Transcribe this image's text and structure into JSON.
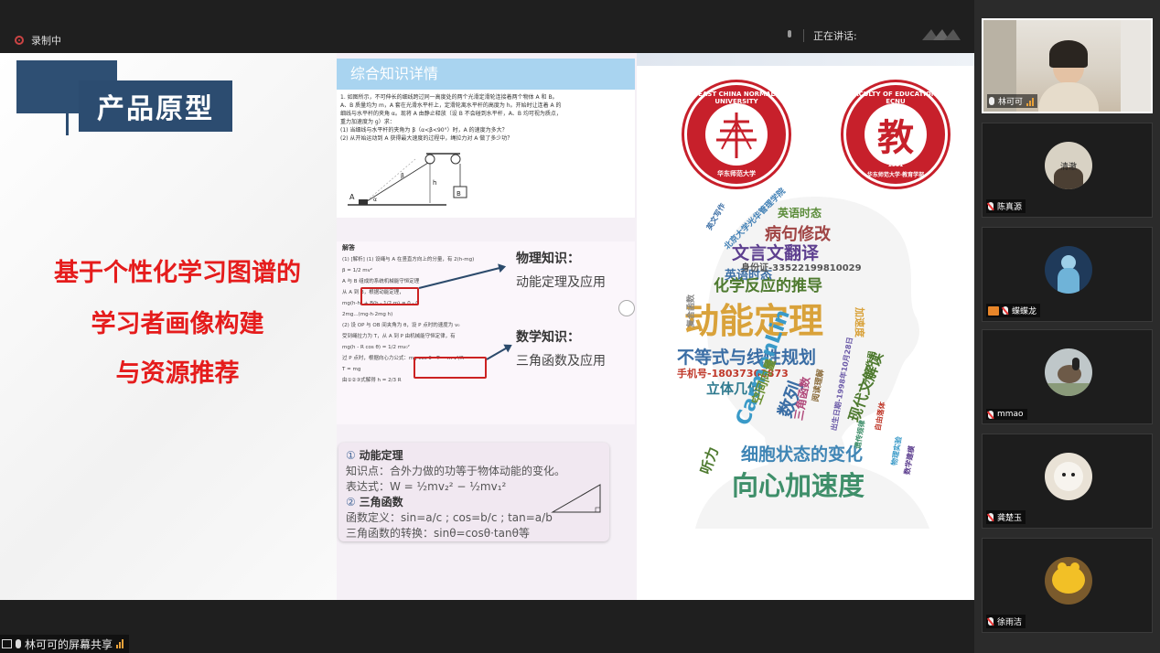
{
  "topbar": {
    "recording_label": "录制中",
    "speaking_label": "正在讲话:"
  },
  "slide": {
    "left": {
      "title": "产品原型",
      "lines": [
        "基于个性化学习图谱的",
        "学习者画像构建",
        "与资源推荐"
      ]
    },
    "middle": {
      "header": "综合知识详情",
      "question_lines": [
        "1. 如图所示，不可伸长的细线跨过同一高度处的两个光滑定滑轮连接着两个物体 A 和 B。",
        "A、B 质量均为 m，A 套在光滑水平杆上，定滑轮离水平杆的高度为 h。开始时让连着 A 的",
        "细线与水平杆的夹角 α。现将 A 由静止释放（设 B 不会碰到水平杆，A、B 均可视为质点，",
        "重力加速度为 g）求：",
        "(1) 当细线与水平杆的夹角为 β（α<β<90°）时，A 的速度为多大？",
        "(2) 从开始运动到 A 获得最大速度的过程中，绳拉力对 A 做了多少功？"
      ],
      "diagram_labels": {
        "a": "A",
        "b": "B",
        "h": "h",
        "alpha": "α",
        "beta": "β"
      },
      "solution_label": "解答",
      "solution_lines": [
        "(1) [解析] (1) 设绳与 A 在竖直方向上的分量，有 2(h-mg)",
        "β = 1/2 mv²",
        "A 与 B 组成的系统机械能守恒定理",
        "从 A 到 B，根据动能定理，",
        "mg(h-h) + B(h - 1/2 m) = 0 - 0",
        "2mg...(mg·h·2mg h)",
        "(2) 设 OP 与 OB 间夹角为 θ，设 P 点时的速度为 v₀",
        "受到绳拉力为 T，从 A 到 P 由机械能守恒定律，有",
        "mg(h - R cos θ) = 1/2 mv₀²",
        "过 P 点时，根据向心力公式：mg cos θ - T = m v²/R",
        "T = mg",
        "由①②③式解得 h = 2/3 R"
      ],
      "physics_title": "物理知识：",
      "physics_sub": "动能定理及应用",
      "math_title": "数学知识：",
      "math_sub": "三角函数及应用",
      "card": {
        "item1_num": "①",
        "item1_title": "动能定理",
        "item1_line1": "知识点：合外力做的功等于物体动能的变化。",
        "item1_line2": "表达式：W = ½mv₂² − ½mv₁²",
        "item2_num": "②",
        "item2_title": "三角函数",
        "item2_line1": "函数定义：sin=a/c ; cos=b/c ; tan=a/b",
        "item2_line2": "三角函数的转换：sinθ=cosθ·tanθ等"
      }
    },
    "right": {
      "seal1_text": "EAST CHINA NORMAL UNIVERSITY",
      "seal1_bottom": "华东师范大学",
      "seal2_text": "FACULTY OF EDUCATION · ECNU",
      "seal2_bottom": "华东师范大学·教育学部",
      "seal2_year": "1951",
      "wordcloud": [
        {
          "text": "动能定理",
          "color": "#d9a23a"
        },
        {
          "text": "向心加速度",
          "color": "#3f8f6a"
        },
        {
          "text": "化学反应的推导",
          "color": "#4e7a2f"
        },
        {
          "text": "不等式与线性规划",
          "color": "#3b6ea5"
        },
        {
          "text": "细胞状态的变化",
          "color": "#3f85b5"
        },
        {
          "text": "文言文翻译",
          "color": "#5d3f8f"
        },
        {
          "text": "病句修改",
          "color": "#a04545"
        },
        {
          "text": "英语时态",
          "color": "#5b8c3a"
        },
        {
          "text": "身份证-33522199810029",
          "color": "#555555"
        },
        {
          "text": "手机号-18037362873",
          "color": "#c0392b"
        },
        {
          "text": "立体几何",
          "color": "#2f7a8f"
        },
        {
          "text": "CarmenLin",
          "color": "#3a9ac8"
        },
        {
          "text": "数列",
          "color": "#3b6ea5"
        },
        {
          "text": "现代文解读",
          "color": "#4e7a2f"
        },
        {
          "text": "空间向量",
          "color": "#6b8f2f"
        },
        {
          "text": "三角函数",
          "color": "#b0487a"
        },
        {
          "text": "北京大学光华管理学院",
          "color": "#3f7fb5"
        },
        {
          "text": "听力",
          "color": "#4e7a2f"
        },
        {
          "text": "加速度",
          "color": "#d9a23a"
        },
        {
          "text": "出生日期-1998年10月28日",
          "color": "#6b5aa8"
        },
        {
          "text": "复合函数",
          "color": "#888888"
        },
        {
          "text": "英文写作",
          "color": "#3b6ea5"
        },
        {
          "text": "光合作用",
          "color": "#4e7a2f"
        },
        {
          "text": "阅读理解",
          "color": "#8a6b3a"
        },
        {
          "text": "自由落体",
          "color": "#c0392b"
        },
        {
          "text": "遗传规律",
          "color": "#3f8f6a"
        },
        {
          "text": "物理实验",
          "color": "#3a9ac8"
        },
        {
          "text": "数学建模",
          "color": "#5d3f8f"
        }
      ]
    }
  },
  "bottombar": {
    "share_label": "林可可的屏幕共享"
  },
  "participants": [
    {
      "name": "林可可",
      "mic": "on",
      "video": true
    },
    {
      "name": "陈真源",
      "mic": "muted",
      "avatar_label": "清澈"
    },
    {
      "name": "蝶蝶龙",
      "mic": "muted",
      "camera_badge": true
    },
    {
      "name": "mmao",
      "mic": "muted"
    },
    {
      "name": "龚楚玉",
      "mic": "muted"
    },
    {
      "name": "徐雨洁",
      "mic": "muted"
    }
  ],
  "colors": {
    "title_navy": "#2c4c70",
    "red_text": "#e51c1c",
    "header_blue": "#a9d4f0",
    "seal_red": "#c7202b",
    "audio_bars": "#e8a13a"
  }
}
